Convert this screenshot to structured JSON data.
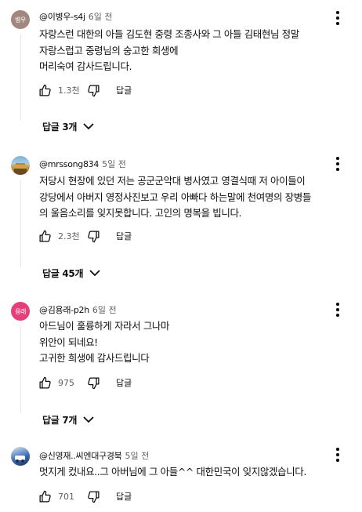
{
  "comments": [
    {
      "avatar_text": "병우",
      "avatar_color": "#a1887f",
      "handle": "@이병우-s4j",
      "time": "6일 전",
      "lines": [
        "자랑스런 대한의 아들  김도현 중령 조종사와 그 아들 김태현님 정말",
        "자랑스럽고 중령님의 숭고한 희생에",
        "머리숙여 감사드립니다."
      ],
      "likes": "1.3천",
      "reply_label": "답글",
      "replies_label": "답글 3개"
    },
    {
      "avatar_text": "",
      "avatar_color": "#4a7a9c",
      "handle": "@mrssong834",
      "time": "5일 전",
      "lines": [
        "저당시 현장에 있던 저는 공군군악대 병사였고 영결식때 저 아이들이",
        "강당에서 아버지 영정사진보고 우리 아빠다 하는말에 천여명의 장병들",
        "의 울음소리를 잊지못합니다. 고인의 명복을 빕니다."
      ],
      "likes": "2.3천",
      "reply_label": "답글",
      "replies_label": "답글 45개"
    },
    {
      "avatar_text": "용래",
      "avatar_color": "#e53e7b",
      "handle": "@김용래-p2h",
      "time": "6일 전",
      "lines": [
        "아드님이 훌륭하게 자라서 그나마",
        "위안이 되네요!",
        "고귀한 희생에 감사드립니다"
      ],
      "likes": "975",
      "reply_label": "답글",
      "replies_label": "답글 7개"
    },
    {
      "avatar_text": "",
      "avatar_color": "#3d6fb5",
      "handle": "@신영재..씨엔대구경북",
      "time": "5일 전",
      "lines": [
        "멋지게 컸내요..그 아버님에 그 아들^^ 대한민국이 잊지않겠습니다."
      ],
      "likes": "701",
      "reply_label": "답글"
    }
  ]
}
